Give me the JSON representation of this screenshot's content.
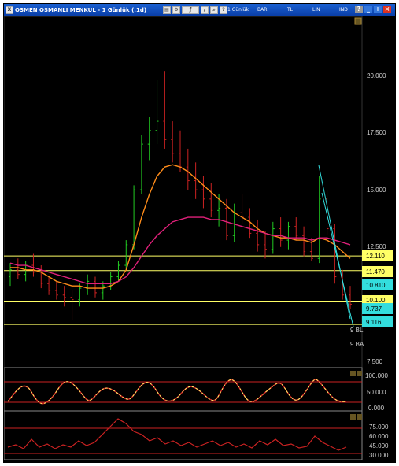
{
  "window": {
    "title": "OSMEN OSMANLI MENKUL - 1 Günlük (.1d)",
    "menu_gunluk": "1 Günlük",
    "menu_bar": "BAR",
    "menu_tl": "TL",
    "menu_lin": "LIN",
    "menu_ind": "IND"
  },
  "price_axis": [
    "20.000",
    "17.500",
    "15.000",
    "12.500",
    "7.500"
  ],
  "price_boxes": [
    {
      "label": "12.110",
      "color": "#ffff66"
    },
    {
      "label": "11.470",
      "color": "#ffff66"
    },
    {
      "label": "10.810",
      "color": "#33dddd"
    },
    {
      "label": "10.100",
      "color": "#ffff66"
    },
    {
      "label": "9.737",
      "color": "#33dddd"
    },
    {
      "label": "9.116",
      "color": "#33dddd"
    }
  ],
  "annotations": [
    "9 BL",
    "9 BA"
  ],
  "panel2_axis": [
    "100.000",
    "50.000",
    "0.000"
  ],
  "panel3_axis": [
    "75.000",
    "60.000",
    "45.000",
    "30.000"
  ],
  "colors": {
    "background": "#000000",
    "bar_up": "#22cc22",
    "bar_down": "#cc2222",
    "ma_fast": "#ff8c1a",
    "ma_slow": "#e0207a",
    "hline": "#ffff66",
    "trend": "#33dddd"
  },
  "chart_data": {
    "type": "bar",
    "title": "OSMEN OSMANLI MENKUL - 1 Günlük (.1d)",
    "ylim": [
      7.0,
      21.0
    ],
    "horizontal_levels": [
      12.11,
      11.47,
      10.1,
      9.116
    ],
    "ohlc_series": [
      [
        11.2,
        11.8,
        10.8,
        11.5
      ],
      [
        11.5,
        12.0,
        11.1,
        11.3
      ],
      [
        11.3,
        11.9,
        11.0,
        11.7
      ],
      [
        11.7,
        12.2,
        11.2,
        11.4
      ],
      [
        11.4,
        11.7,
        10.7,
        10.9
      ],
      [
        10.9,
        11.2,
        10.4,
        10.6
      ],
      [
        10.6,
        11.0,
        10.2,
        10.4
      ],
      [
        10.4,
        10.8,
        9.9,
        10.3
      ],
      [
        10.3,
        10.6,
        9.3,
        10.2
      ],
      [
        10.2,
        10.9,
        9.9,
        10.7
      ],
      [
        10.7,
        11.3,
        10.4,
        11.0
      ],
      [
        11.0,
        11.2,
        10.3,
        10.5
      ],
      [
        10.5,
        11.0,
        10.2,
        10.8
      ],
      [
        10.8,
        11.4,
        10.6,
        11.2
      ],
      [
        11.2,
        11.9,
        11.0,
        11.7
      ],
      [
        11.7,
        12.8,
        11.5,
        12.6
      ],
      [
        12.6,
        15.2,
        12.4,
        15.0
      ],
      [
        15.0,
        17.4,
        14.8,
        17.0
      ],
      [
        17.0,
        18.2,
        16.3,
        17.6
      ],
      [
        17.6,
        19.8,
        17.0,
        18.0
      ],
      [
        18.0,
        20.2,
        16.8,
        17.2
      ],
      [
        17.2,
        18.0,
        16.2,
        16.6
      ],
      [
        16.6,
        17.6,
        15.8,
        16.0
      ],
      [
        16.0,
        16.8,
        15.0,
        15.4
      ],
      [
        15.4,
        16.2,
        14.6,
        15.0
      ],
      [
        15.0,
        15.6,
        14.2,
        14.6
      ],
      [
        14.6,
        15.3,
        13.8,
        14.1
      ],
      [
        14.1,
        14.8,
        13.4,
        14.2
      ],
      [
        14.2,
        14.6,
        12.8,
        13.0
      ],
      [
        13.0,
        14.4,
        12.7,
        14.0
      ],
      [
        14.0,
        14.8,
        13.5,
        13.8
      ],
      [
        13.8,
        14.2,
        12.9,
        13.1
      ],
      [
        13.1,
        13.7,
        12.3,
        12.6
      ],
      [
        12.6,
        13.2,
        12.0,
        12.4
      ],
      [
        12.4,
        13.6,
        12.2,
        13.3
      ],
      [
        13.3,
        13.8,
        12.5,
        12.8
      ],
      [
        12.8,
        13.6,
        12.4,
        13.4
      ],
      [
        13.4,
        13.8,
        12.8,
        13.0
      ],
      [
        13.0,
        13.4,
        12.1,
        12.3
      ],
      [
        12.3,
        12.9,
        11.9,
        12.0
      ],
      [
        12.0,
        15.6,
        11.8,
        14.6
      ],
      [
        14.6,
        15.0,
        13.0,
        13.3
      ],
      [
        13.3,
        13.5,
        10.9,
        11.2
      ],
      [
        11.2,
        11.5,
        10.2,
        10.4
      ],
      [
        10.4,
        10.8,
        9.8,
        10.0
      ]
    ],
    "series": [
      {
        "name": "ma_fast",
        "values": [
          11.6,
          11.6,
          11.5,
          11.5,
          11.4,
          11.2,
          11.0,
          10.9,
          10.8,
          10.8,
          10.7,
          10.7,
          10.7,
          10.8,
          11.0,
          11.5,
          12.6,
          13.8,
          14.8,
          15.6,
          16.0,
          16.1,
          16.0,
          15.8,
          15.5,
          15.2,
          14.9,
          14.6,
          14.3,
          14.0,
          13.8,
          13.6,
          13.3,
          13.1,
          13.0,
          12.9,
          12.9,
          12.8,
          12.8,
          12.7,
          12.9,
          12.8,
          12.6,
          12.3,
          12.0
        ]
      },
      {
        "name": "ma_slow",
        "values": [
          11.8,
          11.7,
          11.7,
          11.6,
          11.5,
          11.4,
          11.3,
          11.2,
          11.1,
          11.0,
          10.9,
          10.9,
          10.9,
          10.9,
          11.0,
          11.2,
          11.6,
          12.1,
          12.6,
          13.0,
          13.3,
          13.6,
          13.7,
          13.8,
          13.8,
          13.8,
          13.7,
          13.7,
          13.6,
          13.5,
          13.4,
          13.3,
          13.2,
          13.1,
          13.0,
          13.0,
          12.9,
          12.9,
          12.9,
          12.8,
          12.9,
          12.9,
          12.8,
          12.7,
          12.6
        ]
      }
    ]
  }
}
